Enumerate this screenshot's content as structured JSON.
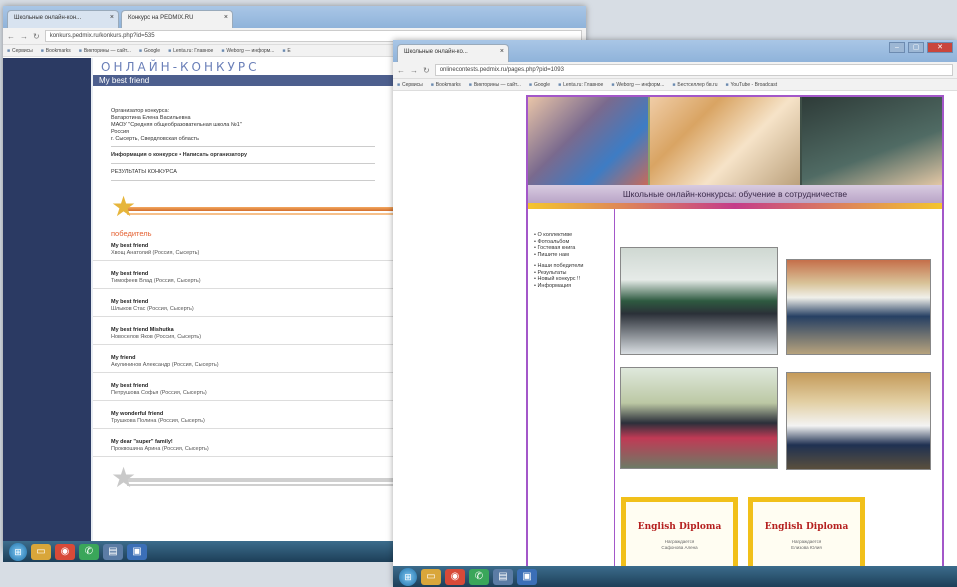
{
  "window1": {
    "tabs": [
      {
        "label": "Школьные онлайн-кон...",
        "active": false
      },
      {
        "label": "Конкурс на PEDMIX.RU",
        "active": true
      }
    ],
    "url": "konkurs.pedmix.ru/konkurs.php?id=535",
    "bookmarks": [
      "Сервисы",
      "Bookmarks",
      "Викторины — сайт...",
      "Google",
      "Lenta.ru: Главное",
      "Weborg — информ...",
      "Е"
    ],
    "logo": "ОНЛАЙН-КОНКУРС",
    "title": "My best friend",
    "organizer": [
      "Организатор конкурса:",
      "Ватаротина Елена Васильевна",
      "МАОУ \"Средняя общеобразовательная школа №1\"",
      "Россия",
      "г. Сысерть, Свердловская область"
    ],
    "info_link": "Информация о конкурсе • Написать организатору",
    "results_label": "РЕЗУЛЬТАТЫ КОНКУРСА",
    "winners_heading": "победитель",
    "entries": [
      {
        "title": "My best friend",
        "author": "Хвощ Анатолий (Россия, Сысерть)"
      },
      {
        "title": "My best friend",
        "author": "Тимофеев Влад (Россия, Сысерть)"
      },
      {
        "title": "My best friend",
        "author": "Шлыков Стас (Россия, Сысерть)"
      },
      {
        "title": "My best friend Mishutka",
        "author": "Новоселов Яков (Россия, Сысерть)"
      },
      {
        "title": "My friend",
        "author": "Акулининов Александр (Россия, Сысерть)"
      },
      {
        "title": "My best friend",
        "author": "Петрушова Софья (Россия, Сысерть)"
      },
      {
        "title": "My wonderful friend",
        "author": "Трушкова Полина (Россия, Сысерть)"
      },
      {
        "title": "My dear \"super\" family!",
        "author": "Проквошина Арина (Россия, Сысерть)"
      }
    ]
  },
  "window2": {
    "tabs": [
      {
        "label": "Школьные онлайн-ко...",
        "active": true
      }
    ],
    "url": "onlinecontests.pedmix.ru/pages.php?pid=1093",
    "bookmarks": [
      "Сервисы",
      "Bookmarks",
      "Викторины — сайт...",
      "Google",
      "Lenta.ru: Главное",
      "Weborg — информ...",
      "Бестселлер бв.ru",
      "YouTube - Broadcast"
    ],
    "banner_caption": "Школьные онлайн-конкурсы: обучение в сотрудничестве",
    "menu_group1": [
      "О коллективе",
      "Фотоальбом",
      "Гостевая книга",
      "Пишите нам"
    ],
    "menu_group2": [
      "Наши победители",
      "Результаты",
      "Новый конкурс !!",
      "Информация"
    ],
    "diplomas": [
      {
        "title": "English Diploma",
        "sub": "Награждается\nСафонова Алена"
      },
      {
        "title": "English Diploma",
        "sub": "Награждается\nЕлизова Юлия"
      }
    ]
  },
  "taskbar_icons": [
    "windows-start",
    "folder",
    "chrome",
    "whatsapp",
    "document",
    "app"
  ]
}
